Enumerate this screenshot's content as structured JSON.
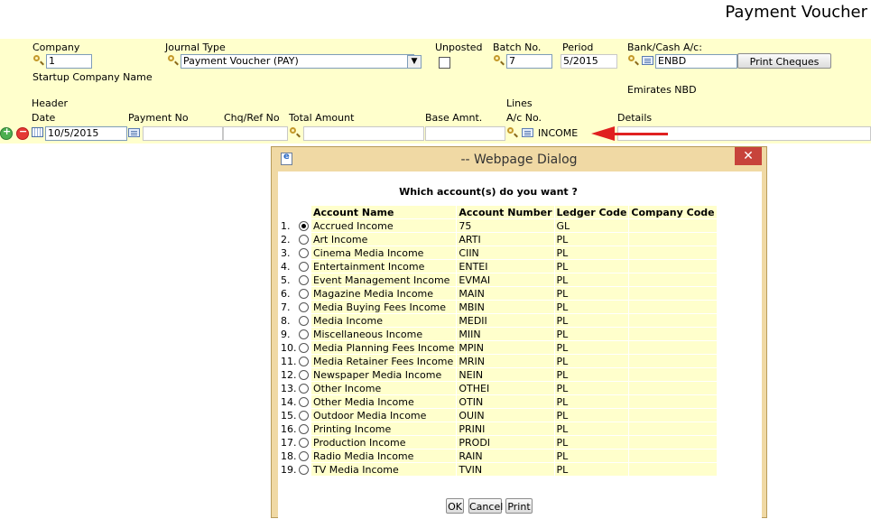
{
  "page_title": "Payment Voucher",
  "header": {
    "company_label": "Company",
    "company_value": "1",
    "company_name": "Startup Company Name",
    "journal_type_label": "Journal Type",
    "journal_type_value": "Payment Voucher (PAY)",
    "unposted_label": "Unposted",
    "batch_label": "Batch No.",
    "batch_value": "7",
    "period_label": "Period",
    "period_value": "5/2015",
    "bank_label": "Bank/Cash A/c:",
    "bank_value": "ENBD",
    "bank_name": "Emirates NBD",
    "print_cheques_label": "Print Cheques",
    "section_header": "Header",
    "section_lines": "Lines",
    "date_label": "Date",
    "date_value": "10/5/2015",
    "payment_no_label": "Payment No",
    "chq_label": "Chq/Ref No",
    "total_label": "Total Amount",
    "base_label": "Base Amnt.",
    "acno_label": "A/c No.",
    "acno_value": "INCOME",
    "details_label": "Details"
  },
  "dialog": {
    "title": "-- Webpage Dialog",
    "close_label": "✕",
    "question": "Which account(s) do you want ?",
    "columns": [
      "Account Name",
      "Account Number",
      "Ledger Code",
      "Company Code"
    ],
    "rows": [
      {
        "no": "1.",
        "name": "Accrued Income",
        "number": "75",
        "ledger": "GL",
        "company": "",
        "selected": true
      },
      {
        "no": "2.",
        "name": "Art Income",
        "number": "ARTI",
        "ledger": "PL",
        "company": ""
      },
      {
        "no": "3.",
        "name": "Cinema Media Income",
        "number": "CIIN",
        "ledger": "PL",
        "company": ""
      },
      {
        "no": "4.",
        "name": "Entertainment Income",
        "number": "ENTEI",
        "ledger": "PL",
        "company": ""
      },
      {
        "no": "5.",
        "name": "Event Management Income",
        "number": "EVMAI",
        "ledger": "PL",
        "company": ""
      },
      {
        "no": "6.",
        "name": "Magazine Media Income",
        "number": "MAIN",
        "ledger": "PL",
        "company": ""
      },
      {
        "no": "7.",
        "name": "Media Buying Fees Income",
        "number": "MBIN",
        "ledger": "PL",
        "company": ""
      },
      {
        "no": "8.",
        "name": "Media Income",
        "number": "MEDII",
        "ledger": "PL",
        "company": ""
      },
      {
        "no": "9.",
        "name": "Miscellaneous Income",
        "number": "MIIN",
        "ledger": "PL",
        "company": ""
      },
      {
        "no": "10.",
        "name": "Media Planning Fees Income",
        "number": "MPIN",
        "ledger": "PL",
        "company": ""
      },
      {
        "no": "11.",
        "name": "Media Retainer Fees Income",
        "number": "MRIN",
        "ledger": "PL",
        "company": ""
      },
      {
        "no": "12.",
        "name": "Newspaper Media Income",
        "number": "NEIN",
        "ledger": "PL",
        "company": ""
      },
      {
        "no": "13.",
        "name": "Other Income",
        "number": "OTHEI",
        "ledger": "PL",
        "company": ""
      },
      {
        "no": "14.",
        "name": "Other Media Income",
        "number": "OTIN",
        "ledger": "PL",
        "company": ""
      },
      {
        "no": "15.",
        "name": "Outdoor Media Income",
        "number": "OUIN",
        "ledger": "PL",
        "company": ""
      },
      {
        "no": "16.",
        "name": "Printing Income",
        "number": "PRINI",
        "ledger": "PL",
        "company": ""
      },
      {
        "no": "17.",
        "name": "Production Income",
        "number": "PRODI",
        "ledger": "PL",
        "company": ""
      },
      {
        "no": "18.",
        "name": "Radio Media Income",
        "number": "RAIN",
        "ledger": "PL",
        "company": ""
      },
      {
        "no": "19.",
        "name": "TV Media Income",
        "number": "TVIN",
        "ledger": "PL",
        "company": ""
      }
    ],
    "buttons": {
      "ok": "OK",
      "cancel": "Cancel",
      "print": "Print"
    }
  },
  "colors": {
    "band": "#ffffcc",
    "dialog_frame": "#f0d9a4",
    "close_button": "#c7433b",
    "arrow": "#e02020"
  }
}
